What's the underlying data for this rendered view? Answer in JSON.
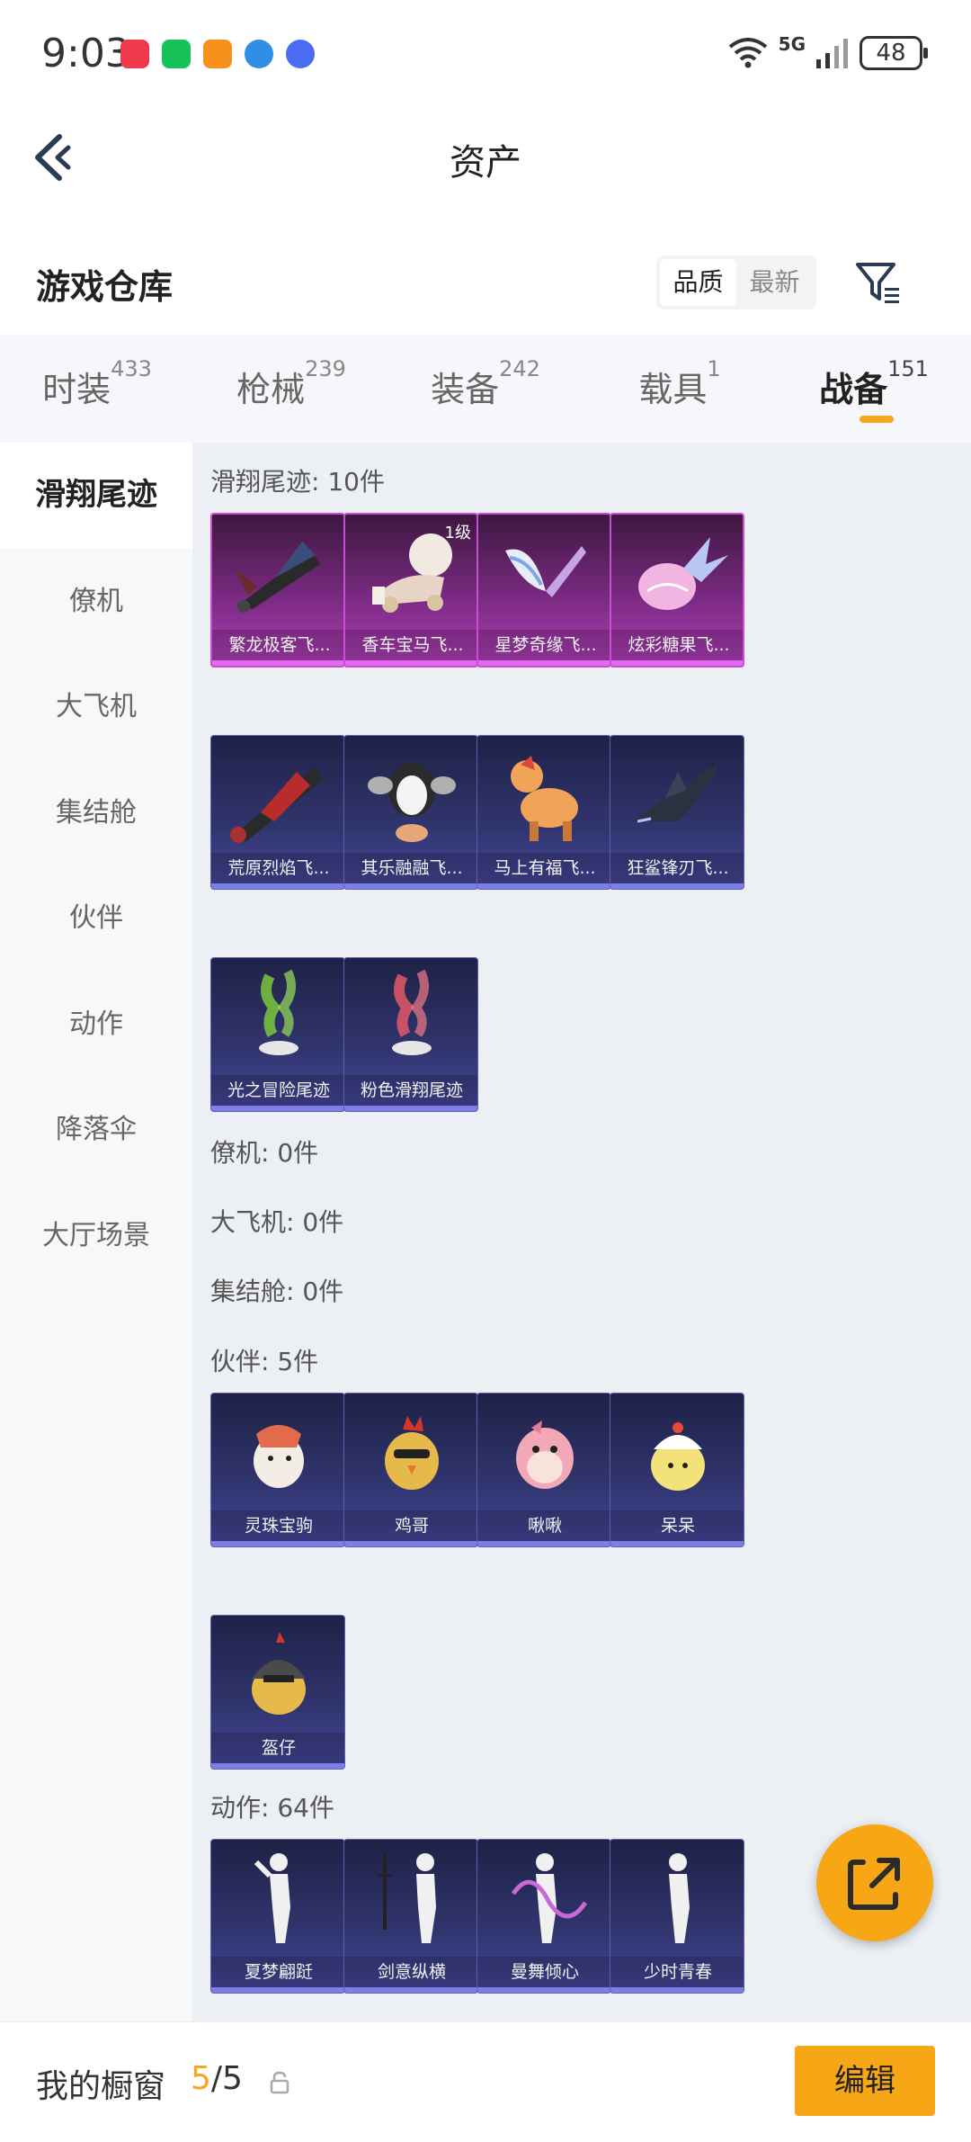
{
  "status_bar": {
    "time": "9:03",
    "network": "5G",
    "battery": "48"
  },
  "header": {
    "title": "资产"
  },
  "warehouse": {
    "title": "游戏仓库",
    "sort_options": [
      "品质",
      "最新"
    ],
    "active_sort": "品质"
  },
  "tabs": [
    {
      "label": "时装",
      "count": "433"
    },
    {
      "label": "枪械",
      "count": "239"
    },
    {
      "label": "装备",
      "count": "242"
    },
    {
      "label": "载具",
      "count": "1"
    },
    {
      "label": "战备",
      "count": "151"
    }
  ],
  "active_tab": "战备",
  "sidebar": [
    {
      "label": "滑翔尾迹"
    },
    {
      "label": "僚机"
    },
    {
      "label": "大飞机"
    },
    {
      "label": "集结舱"
    },
    {
      "label": "伙伴"
    },
    {
      "label": "动作"
    },
    {
      "label": "降落伞"
    },
    {
      "label": "大厅场景"
    }
  ],
  "sections": {
    "glide": {
      "label": "滑翔尾迹: 10件",
      "items": [
        {
          "name": "繁龙极客飞...",
          "quality": "purple",
          "icon": "dragon-glider-icon"
        },
        {
          "name": "香车宝马飞...",
          "quality": "purple",
          "level": "1级",
          "icon": "carriage-glider-icon"
        },
        {
          "name": "星梦奇缘飞...",
          "quality": "purple",
          "icon": "wing-glider-icon"
        },
        {
          "name": "炫彩糖果飞...",
          "quality": "purple",
          "icon": "candy-glider-icon"
        },
        {
          "name": "荒原烈焰飞...",
          "quality": "blue",
          "icon": "flame-glider-icon"
        },
        {
          "name": "其乐融融飞...",
          "quality": "blue",
          "icon": "penguin-glider-icon"
        },
        {
          "name": "马上有福飞...",
          "quality": "blue",
          "icon": "horse-glider-icon"
        },
        {
          "name": "狂鲨锋刃飞...",
          "quality": "blue",
          "icon": "shark-glider-icon"
        },
        {
          "name": "光之冒险尾迹",
          "quality": "blue",
          "icon": "green-smoke-trail-icon"
        },
        {
          "name": "粉色滑翔尾迹",
          "quality": "blue",
          "icon": "pink-smoke-trail-icon"
        }
      ]
    },
    "wingman": {
      "label": "僚机: 0件"
    },
    "plane": {
      "label": "大飞机: 0件"
    },
    "pod": {
      "label": "集结舱: 0件"
    },
    "partner": {
      "label": "伙伴: 5件",
      "items": [
        {
          "name": "灵珠宝驹",
          "quality": "blue",
          "icon": "pony-partner-icon"
        },
        {
          "name": "鸡哥",
          "quality": "blue",
          "icon": "chicken-partner-icon"
        },
        {
          "name": "啾啾",
          "quality": "blue",
          "icon": "pink-bird-partner-icon"
        },
        {
          "name": "呆呆",
          "quality": "blue",
          "icon": "chick-partner-icon"
        },
        {
          "name": "盔仔",
          "quality": "blue",
          "icon": "helmet-chick-partner-icon"
        }
      ]
    },
    "emote": {
      "label": "动作: 64件",
      "items": [
        {
          "name": "夏梦翩跹",
          "quality": "blue",
          "icon": "dance-emote-icon"
        },
        {
          "name": "剑意纵横",
          "quality": "blue",
          "icon": "sword-emote-icon"
        },
        {
          "name": "曼舞倾心",
          "quality": "blue",
          "icon": "ribbon-dance-emote-icon"
        },
        {
          "name": "少时青春",
          "quality": "blue",
          "icon": "youth-emote-icon"
        }
      ]
    }
  },
  "bottom": {
    "label": "我的橱窗",
    "count_current": "5",
    "count_total": "/5",
    "edit_label": "编辑"
  },
  "colors": {
    "accent": "#f7a616",
    "purple_quality": "#c84fd3",
    "blue_quality": "#45479a"
  }
}
